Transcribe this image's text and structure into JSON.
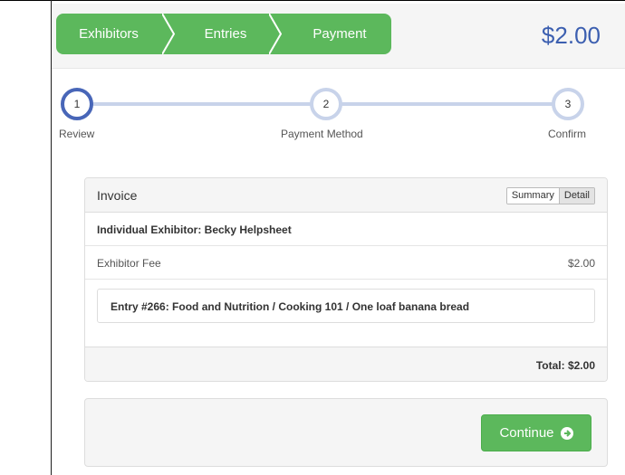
{
  "header": {
    "breadcrumbs": [
      "Exhibitors",
      "Entries",
      "Payment"
    ],
    "amount": "$2.00"
  },
  "steps": [
    {
      "number": "1",
      "label": "Review"
    },
    {
      "number": "2",
      "label": "Payment Method"
    },
    {
      "number": "3",
      "label": "Confirm"
    }
  ],
  "invoice": {
    "title": "Invoice",
    "toggle": {
      "summary": "Summary",
      "detail": "Detail"
    },
    "exhibitor": "Individual Exhibitor: Becky Helpsheet",
    "fee_label": "Exhibitor Fee",
    "fee_value": "$2.00",
    "entry": "Entry #266: Food and Nutrition / Cooking 101 / One loaf banana bread",
    "total": "Total: $2.00"
  },
  "action": {
    "continue_label": "Continue"
  },
  "colors": {
    "accent_green": "#5cb85c",
    "active_step": "#4866b8",
    "inactive_step": "#c8d3ea",
    "amount": "#3c5fb0"
  }
}
